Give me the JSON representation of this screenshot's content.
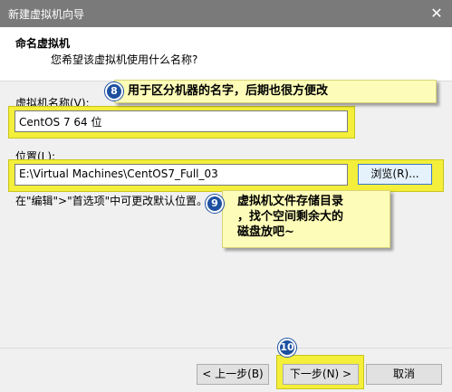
{
  "window": {
    "title": "新建虚拟机向导",
    "close_glyph": "✕"
  },
  "header": {
    "title": "命名虚拟机",
    "subtitle": "您希望该虚拟机使用什么名称?"
  },
  "vm_name": {
    "label": "虚拟机名称(V):",
    "value": "CentOS 7 64 位"
  },
  "location": {
    "label": "位置(L):",
    "value": "E:\\Virtual Machines\\CentOS7_Full_03",
    "browse_label": "浏览(R)...",
    "hint": "在\"编辑\">\"首选项\"中可更改默认位置。"
  },
  "annotations": [
    {
      "number": "8",
      "text": "用于区分机器的名字，后期也很方便改"
    },
    {
      "number": "9",
      "lines": [
        "虚拟机文件存储目录",
        "，找个空间剩余大的",
        "磁盘放吧~"
      ]
    },
    {
      "number": "10"
    }
  ],
  "buttons": {
    "back": "< 上一步(B)",
    "next": "下一步(N) >",
    "cancel": "取消"
  },
  "colors": {
    "highlight": "#f3ef3a",
    "callout": "#fdfcb8",
    "badge": "#1e50a0",
    "titlebar": "#7a7a7a"
  }
}
